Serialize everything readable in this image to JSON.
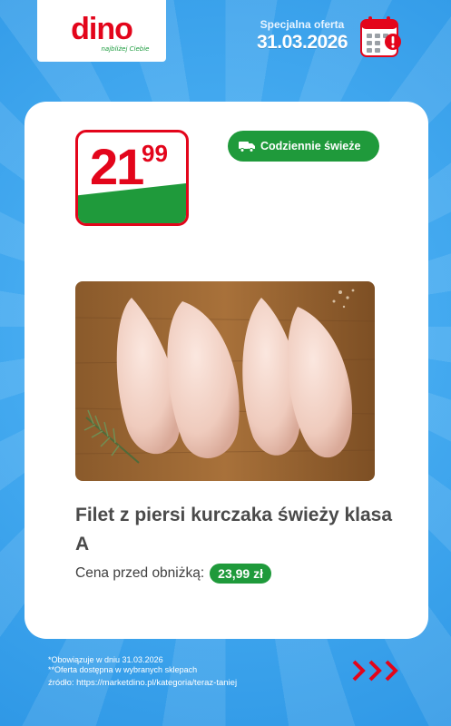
{
  "brand": {
    "name": "dino",
    "tagline": "najbliżej Ciebie"
  },
  "offer": {
    "label": "Specjalna oferta",
    "date": "31.03.2026"
  },
  "product": {
    "price_main": "21",
    "price_cents": "99",
    "fresh_badge": "Codziennie świeże",
    "name": "Filet z piersi kurczaka świeży klasa A",
    "old_price_label": "Cena przed obniżką:",
    "old_price": "23,99 zł"
  },
  "footer": {
    "note1": "*Obowiązuje w dniu 31.03.2026",
    "note2": "**Oferta dostępna w wybranych sklepach",
    "source": "źródło: https://marketdino.pl/kategoria/teraz-taniej"
  },
  "colors": {
    "brand_red": "#e3051b",
    "brand_green": "#1f9a3b",
    "background_blue": "#3aa6ee"
  },
  "icons": [
    "calendar-alert-icon",
    "truck-icon",
    "next-arrows-icon"
  ]
}
